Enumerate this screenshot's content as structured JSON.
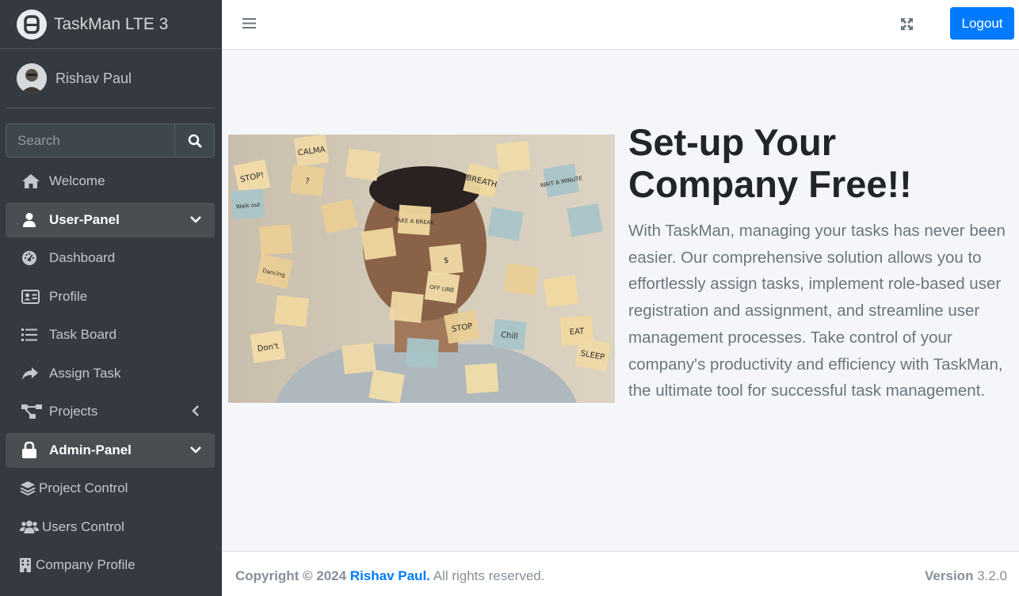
{
  "brand": {
    "name": "TaskMan LTE 3"
  },
  "user": {
    "name": "Rishav Paul"
  },
  "search": {
    "placeholder": "Search"
  },
  "nav": {
    "welcome": "Welcome",
    "user_panel": "User-Panel",
    "dashboard": "Dashboard",
    "profile": "Profile",
    "task_board": "Task Board",
    "assign_task": "Assign Task",
    "projects": "Projects",
    "admin_panel": "Admin-Panel",
    "project_control": "Project Control",
    "users_control": "Users Control",
    "company_profile": "Company Profile"
  },
  "topbar": {
    "logout_label": "Logout"
  },
  "hero": {
    "headline": "Set-up Your Company Free!!",
    "description": "With TaskMan, managing your tasks has never been easier. Our comprehensive solution allows you to effortlessly assign tasks, implement role-based user registration and assignment, and streamline user management processes. Take control of your company's productivity and efficiency with TaskMan, the ultimate tool for successful task management.",
    "sticky_notes": [
      "CALMA",
      "STOP!",
      "?",
      "Walk out",
      "TAKE A BREAK",
      "$",
      "OFF LINE",
      "STOP",
      "Chill",
      "EAT",
      "SLEEP",
      "Don't",
      "Dancing",
      "WAIT A MINUTE",
      "BREATH"
    ]
  },
  "footer": {
    "copyright_prefix": "Copyright © 2024",
    "author": "Rishav Paul.",
    "rights": "All rights reserved.",
    "version_label": "Version",
    "version_number": "3.2.0"
  },
  "colors": {
    "sidebar": "#343a40",
    "accent": "#007bff",
    "content_bg": "#f4f6f9"
  }
}
